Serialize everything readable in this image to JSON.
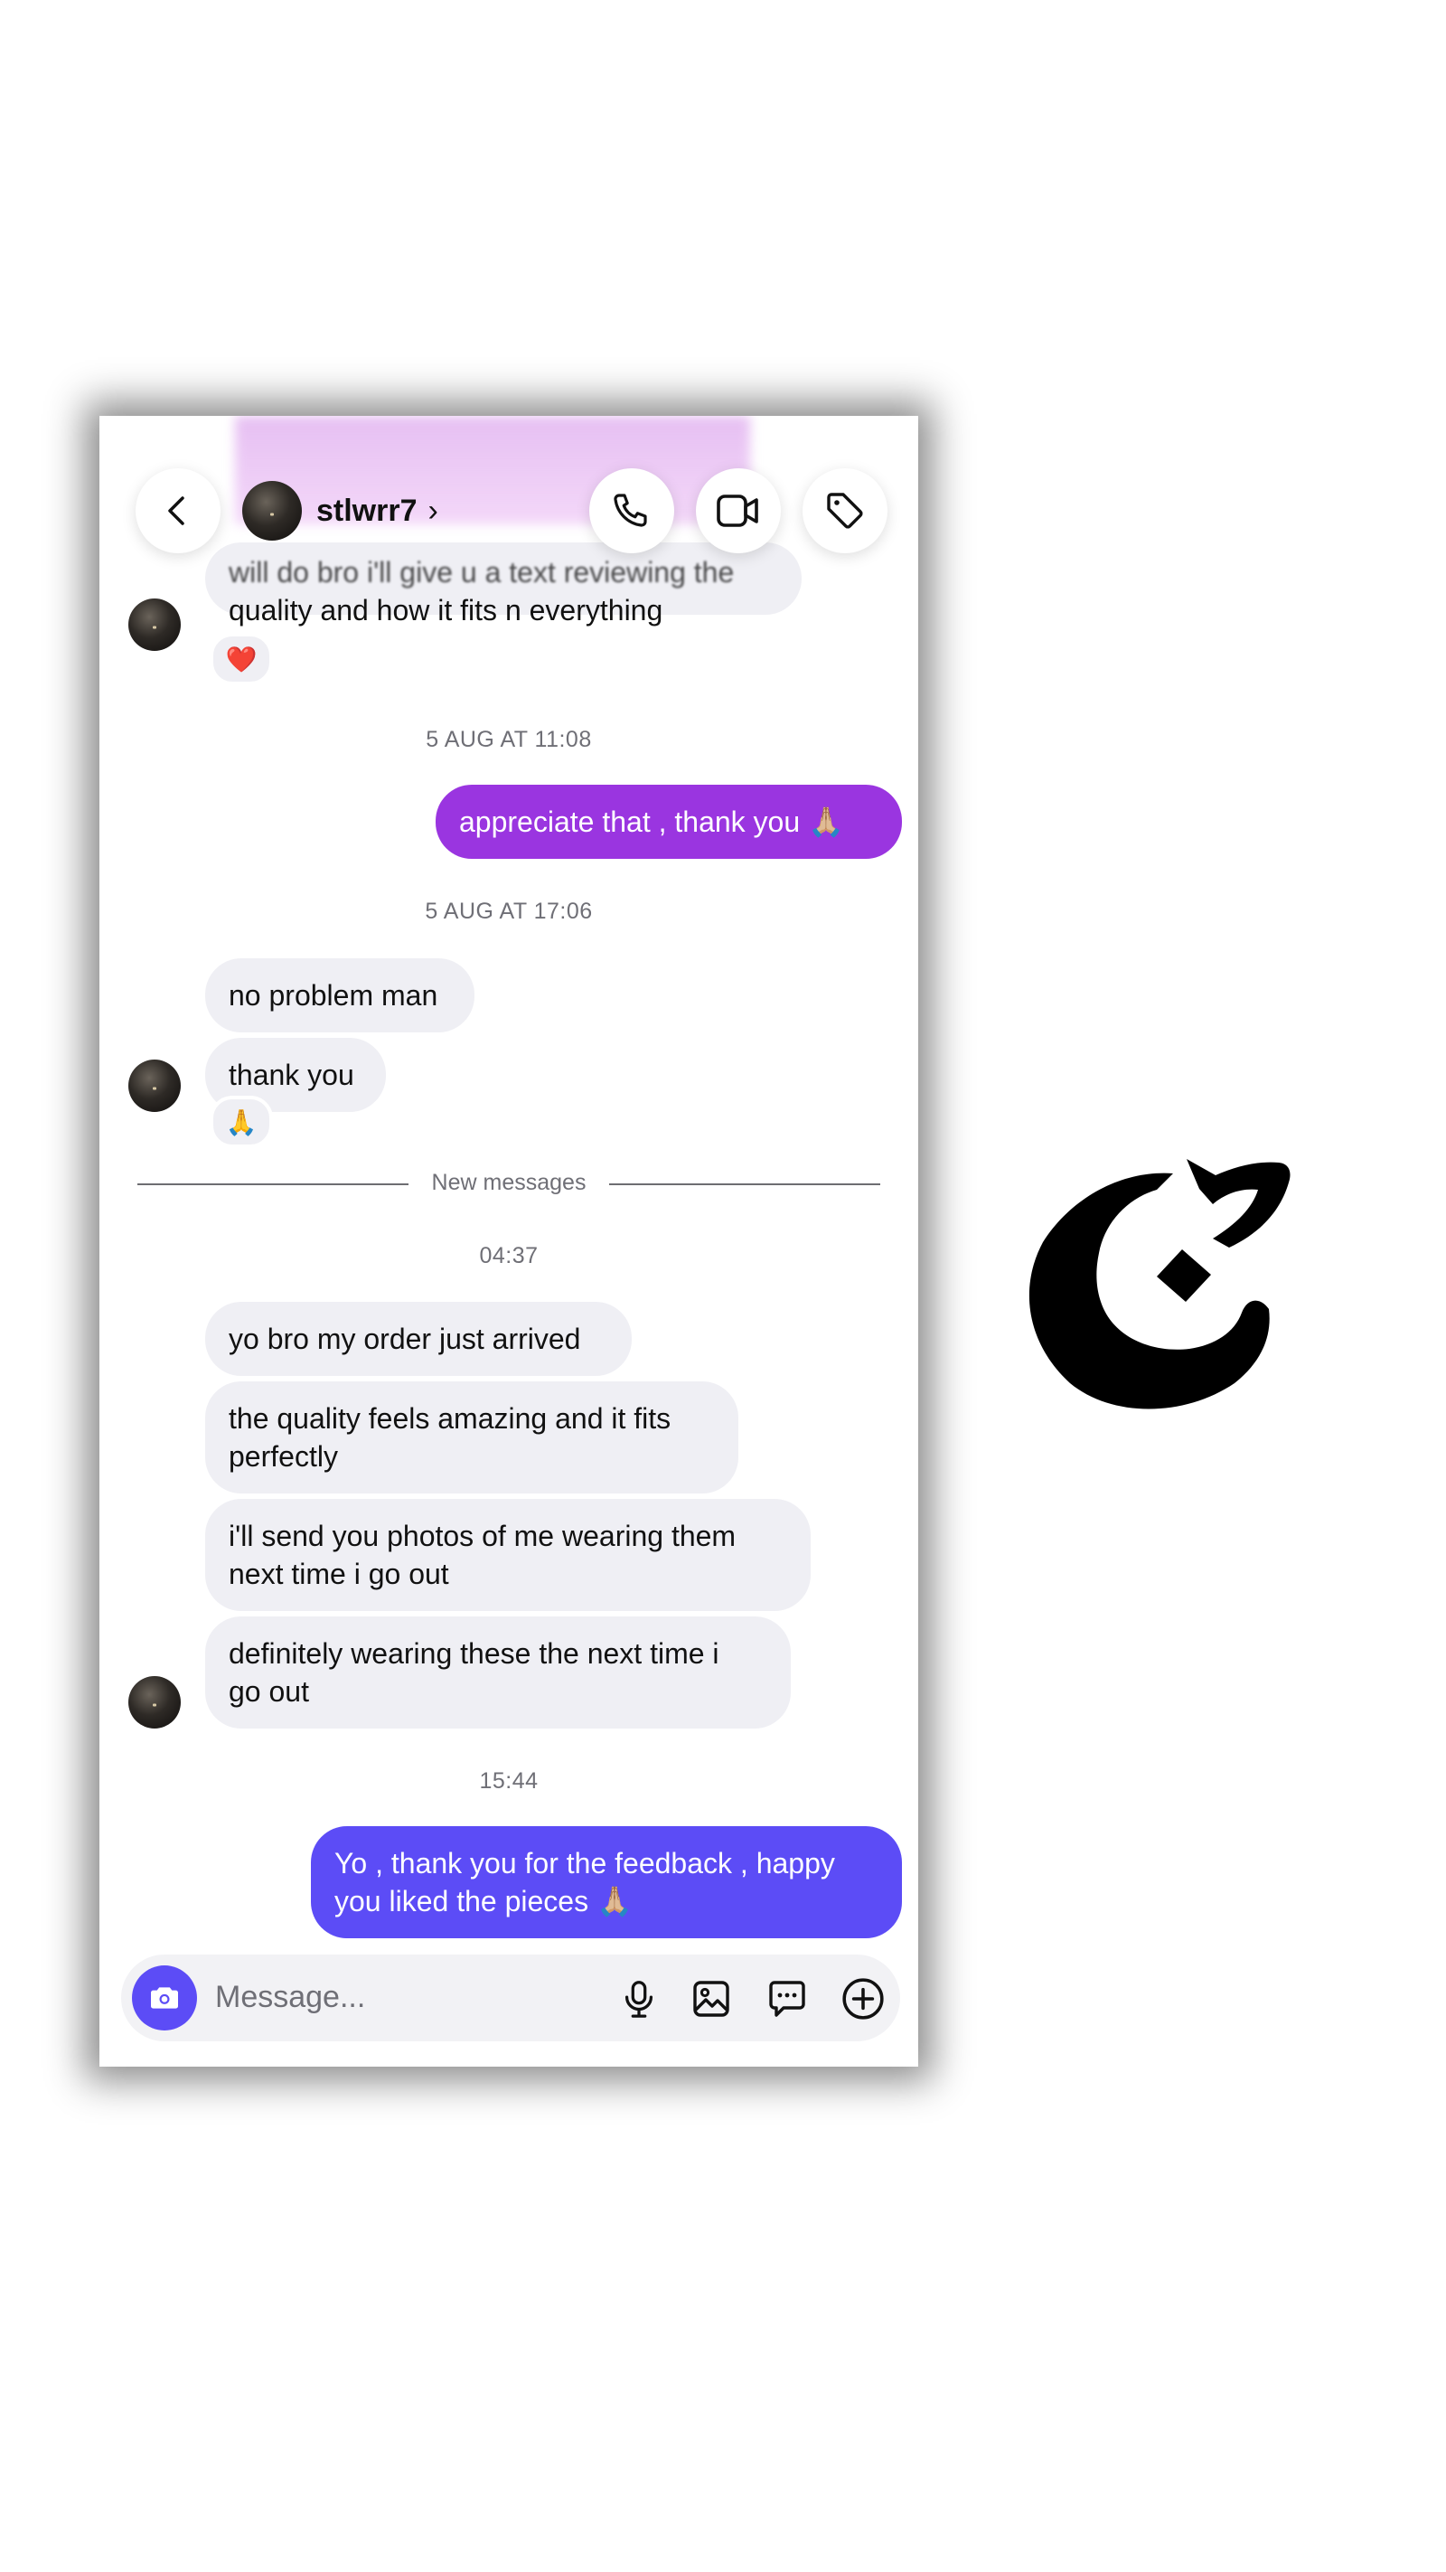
{
  "header": {
    "username": "stlwrr7",
    "chevron": "›",
    "icons": [
      "back-arrow-icon",
      "phone-icon",
      "video-camera-icon",
      "tag-icon"
    ]
  },
  "messages": {
    "m1_line1": "will do bro i'll give u a text reviewing the",
    "m1_line2": "quality and how it fits n everything",
    "m1_reaction": "❤️",
    "ts1": "5 AUG AT 11:08",
    "m2": "appreciate that , thank you 🙏🏼",
    "ts2": "5 AUG AT 17:06",
    "m3": "no problem man",
    "m4": "thank you",
    "m4_reaction": "🙏",
    "new_messages": "New messages",
    "ts3": "04:37",
    "m5": "yo bro my order just arrived",
    "m6_line1": "the quality feels amazing and it fits",
    "m6_line2": "perfectly",
    "m7_line1": "i'll send you photos of me wearing them",
    "m7_line2": "next time i go out",
    "m8_line1": "definitely wearing these the next time i",
    "m8_line2": "go out",
    "ts4": "15:44",
    "m9_line1": "Yo , thank you for the feedback , happy",
    "m9_line2": "you liked the pieces 🙏🏼"
  },
  "composer": {
    "placeholder": "Message...",
    "icons": [
      "camera-icon",
      "microphone-icon",
      "image-icon",
      "sticker-chat-icon",
      "plus-circle-icon"
    ]
  },
  "colors": {
    "outgoing_purple": "#9a35e0",
    "outgoing_indigo": "#5c4cf6",
    "incoming_gray": "#efeff4"
  }
}
